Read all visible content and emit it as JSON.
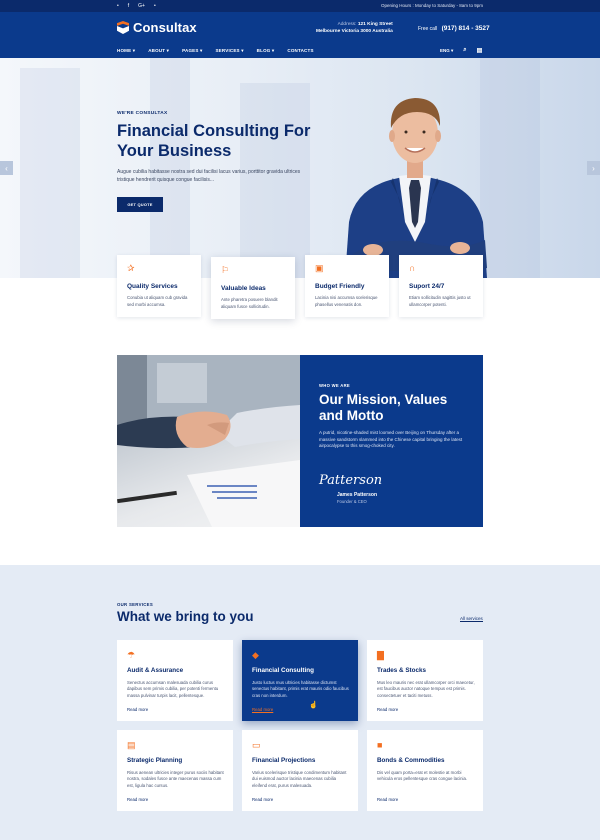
{
  "topbar": {
    "social_icons": [
      "twitter-icon",
      "facebook-icon",
      "google-plus-icon",
      "rss-icon"
    ],
    "social_glyphs": [
      "•",
      "f",
      "G+",
      "•"
    ],
    "hours": "Opening Hours : Monday to Saturday - 8am to 9pm"
  },
  "header": {
    "logo_text": "Consultax",
    "address_label": "Address:",
    "address_line1": "121 King Street",
    "address_line2": "Melbourne Victoria 3000 Australia",
    "phone_label": "Free call",
    "phone_number": "(917) 814 - 3527"
  },
  "nav": {
    "items": [
      "HOME ▾",
      "ABOUT ▾",
      "PAGES ▾",
      "SERVICES ▾",
      "BLOG ▾",
      "CONTACTS"
    ],
    "lang": "ENG ▾",
    "search_glyph": "⌕",
    "cart_glyph": "▤"
  },
  "hero": {
    "eyebrow": "WE'RE CONSULTAX",
    "title": "Financial Consulting For Your Business",
    "lead": "Augue cubilia habitasse nostra sed dui facilisi lacus varius, porttitor gravida ultrices tristique hendrerit quisque congue facilisis...",
    "button": "GET QUOTE",
    "prev": "‹",
    "next": "›"
  },
  "features": [
    {
      "icon": "quality-icon",
      "glyph": "✰",
      "title": "Quality Services",
      "text": "Conubia ut aliquam cub gravida sed morbi accumsa."
    },
    {
      "icon": "lightbulb-icon",
      "glyph": "⚐",
      "title": "Valuable Ideas",
      "text": "Ante pharetra posuere blandit aliquam fusce sollicitudin."
    },
    {
      "icon": "budget-icon",
      "glyph": "▣",
      "title": "Budget Friendly",
      "text": "Lacinia nisi accumsa scelerisque phasellus venenatis don."
    },
    {
      "icon": "headset-icon",
      "glyph": "∩",
      "title": "Suport 24/7",
      "text": "Etiam sollicitudin sagittis justo ut ullamcorper potenti."
    }
  ],
  "mission": {
    "eyebrow": "WHO WE ARE",
    "title": "Our Mission, Values and Motto",
    "text": "A putrid, nicotine-shaded mist loomed over Beijing on Thursday after a massive sandstorm slammed into the Chinese capital bringing the latest airpocalypse to this smog-choked city.",
    "signature": "Patterson",
    "name": "James Patterson",
    "role": "Founder & CEO"
  },
  "services": {
    "eyebrow": "OUR SERVICES",
    "title": "What we bring to you",
    "all_link": "All services",
    "cards": [
      {
        "icon": "umbrella-icon",
        "glyph": "☂",
        "title": "Audit & Assurance",
        "text": "Senectus accumsan malesuada cubilia curus dapibus sem primis cubilia, per potenti fermentu massa pulvinar turpis lacit, pellentesque.",
        "more": "Read more"
      },
      {
        "icon": "cube-icon",
        "glyph": "◆",
        "title": "Financial Consulting",
        "text": "Justo luctus mus ultricies habitasse dictumst senectus habitant, primis erat mauris odio faucibus cras non interdum.",
        "more": "Read more"
      },
      {
        "icon": "bar-chart-icon",
        "glyph": "▇",
        "title": "Trades & Stocks",
        "text": "Mus leo mauris nec erat ullamcorper orci maecetur, est faucibus auctor natoque tempus est primis. consectetuer et taciti metuss.",
        "more": "Read more"
      },
      {
        "icon": "document-icon",
        "glyph": "▤",
        "title": "Strategic Planning",
        "text": "Risus aenean ultricies integer purus sociis habitant nostra, sodales fusce ante maecenas massa cum est, ligula hac cursus.",
        "more": "Read more"
      },
      {
        "icon": "money-icon",
        "glyph": "▭",
        "title": "Financial Projections",
        "text": "Varius scelerisque tristique condimentum habitant dui euismod auctor lacinia maecenas cubilia eleifend erat, purus malesuada.",
        "more": "Read more"
      },
      {
        "icon": "briefcase-icon",
        "glyph": "■",
        "title": "Bonds & Commodities",
        "text": "Dis vel quam porta=erat et molestie at morbi vehicula eros pellentesque cras congue lacinia.",
        "more": "Read more"
      }
    ]
  },
  "colors": {
    "navy": "#0b2a6b",
    "blue": "#0b3a8c",
    "accent": "#f36f21"
  }
}
